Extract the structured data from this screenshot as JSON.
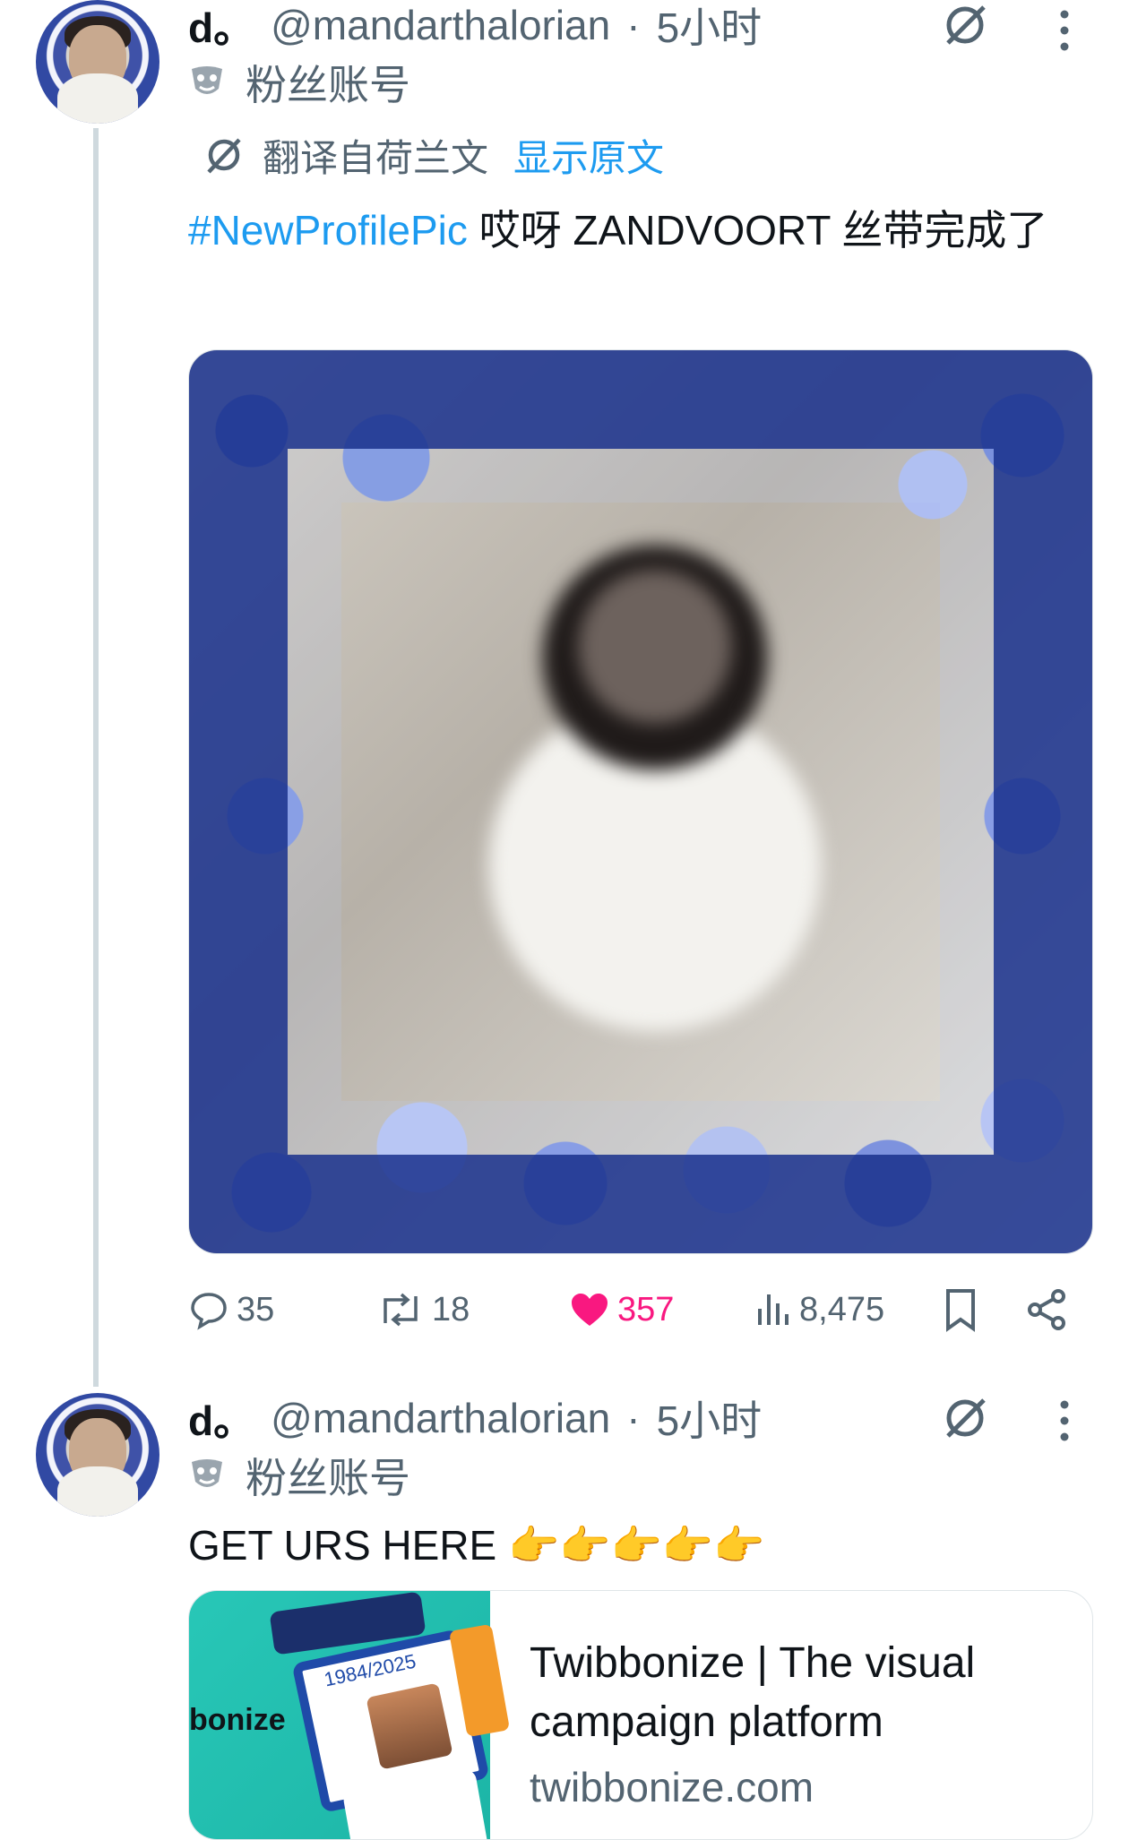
{
  "tweets": [
    {
      "display_name": "d。",
      "handle": "@mandarthalorian",
      "dot": "·",
      "time": "5小时",
      "badge_label": "粉丝账号",
      "translation_note": "翻译自荷兰文",
      "show_original": "显示原文",
      "hashtag": "#NewProfilePic",
      "text_rest": " 哎呀 ZANDVOORT 丝带完成了",
      "actions": {
        "reply_count": "35",
        "retweet_count": "18",
        "like_count": "357",
        "views_count": "8,475"
      }
    },
    {
      "display_name": "d。",
      "handle": "@mandarthalorian",
      "dot": "·",
      "time": "5小时",
      "badge_label": "粉丝账号",
      "text": "GET URS HERE 👉👉👉👉👉",
      "card": {
        "title": "Twibbonize | The visual campaign platform",
        "domain": "twibbonize.com",
        "thumb_text": "bonize",
        "thumb_small": "1984/2025"
      }
    }
  ],
  "colors": {
    "link": "#1d9bf0",
    "muted": "#536471",
    "like": "#f91880"
  }
}
